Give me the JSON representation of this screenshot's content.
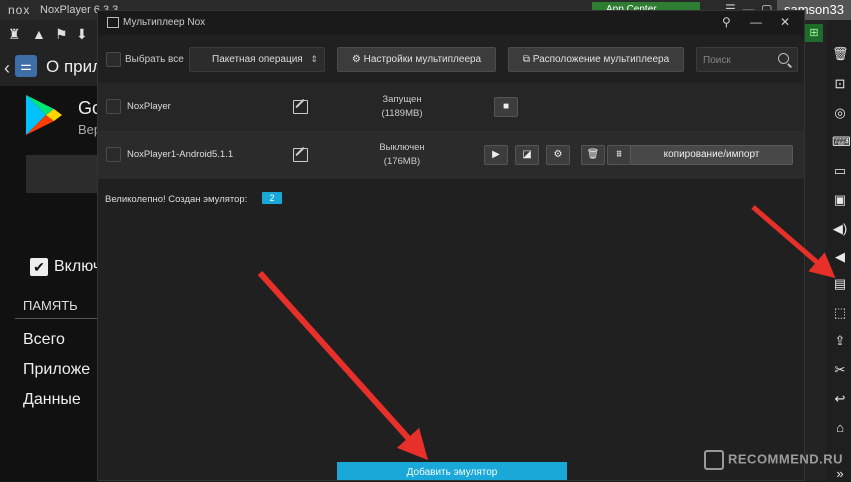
{
  "host": {
    "logo": "nox",
    "title": "NoxPlayer 6.3.3",
    "app_center": "App Center",
    "user": "samson33"
  },
  "android": {
    "appbar_title": "О прил",
    "app_name": "Go",
    "app_version": "Вер",
    "include_label": "Включ",
    "memory_header": "ПАМЯТЬ",
    "memory_items": [
      "Всего",
      "Приложе",
      "Данные"
    ]
  },
  "dialog": {
    "title": "Мультиплеер Nox",
    "select_all": "Выбрать все",
    "batch_operation": "Пакетная операция",
    "settings_button": "⚙ Настройки мультиплеера",
    "layout_button": "⧉ Расположение мультиплеера",
    "search_placeholder": "Поиск",
    "instances": [
      {
        "name": "NoxPlayer",
        "status": "Запущен",
        "memory": "(1189MB)"
      },
      {
        "name": "NoxPlayer1-Android5.1.1",
        "status": "Выключен",
        "memory": "(176MB)"
      }
    ],
    "copy_import": "копирование/импорт",
    "success_message": "Великолепно! Создан эмулятор:",
    "success_count": "2",
    "add_emulator": "Добавить эмулятор"
  },
  "watermark": "RECOMMEND.RU",
  "colors": {
    "accent": "#1aa8d8",
    "arrow": "#e8302a",
    "app_center": "#2e7d32"
  }
}
